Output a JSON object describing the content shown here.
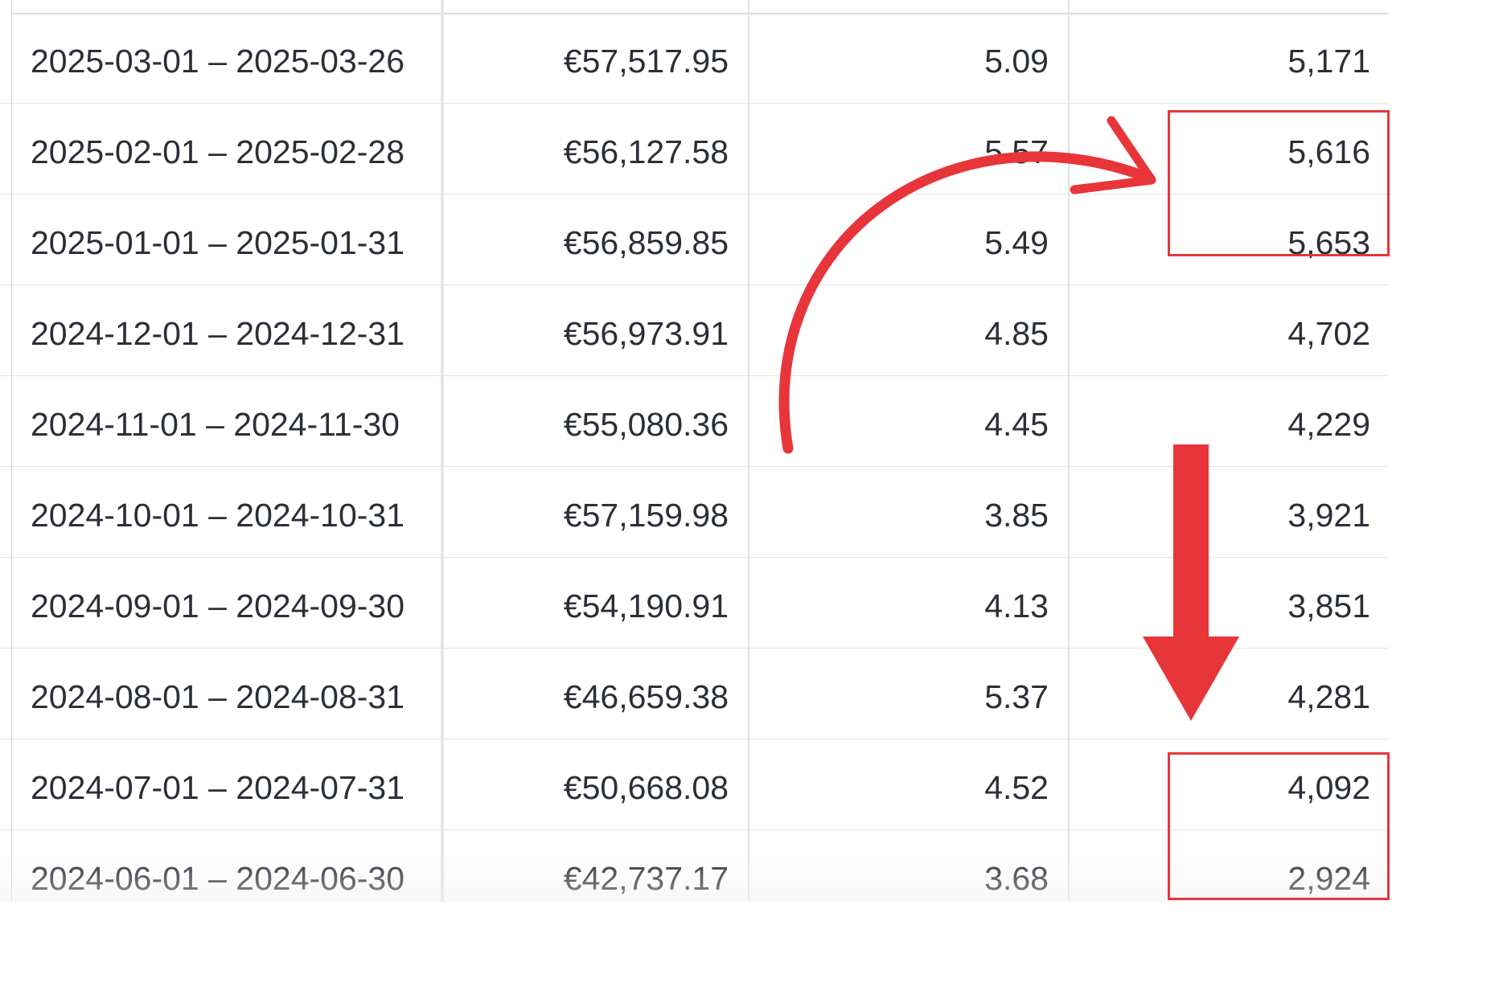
{
  "table": {
    "rows": [
      {
        "range": "2025-03-01 – 2025-03-26",
        "spend": "€57,517.95",
        "rate": "5.09",
        "count": "5,171"
      },
      {
        "range": "2025-02-01 – 2025-02-28",
        "spend": "€56,127.58",
        "rate": "5.57",
        "count": "5,616"
      },
      {
        "range": "2025-01-01 – 2025-01-31",
        "spend": "€56,859.85",
        "rate": "5.49",
        "count": "5,653"
      },
      {
        "range": "2024-12-01 – 2024-12-31",
        "spend": "€56,973.91",
        "rate": "4.85",
        "count": "4,702"
      },
      {
        "range": "2024-11-01 – 2024-11-30",
        "spend": "€55,080.36",
        "rate": "4.45",
        "count": "4,229"
      },
      {
        "range": "2024-10-01 – 2024-10-31",
        "spend": "€57,159.98",
        "rate": "3.85",
        "count": "3,921"
      },
      {
        "range": "2024-09-01 – 2024-09-30",
        "spend": "€54,190.91",
        "rate": "4.13",
        "count": "3,851"
      },
      {
        "range": "2024-08-01 – 2024-08-31",
        "spend": "€46,659.38",
        "rate": "5.37",
        "count": "4,281"
      },
      {
        "range": "2024-07-01 – 2024-07-31",
        "spend": "€50,668.08",
        "rate": "4.52",
        "count": "4,092"
      },
      {
        "range": "2024-06-01 – 2024-06-30",
        "spend": "€42,737.17",
        "rate": "3.68",
        "count": "2,924"
      }
    ]
  },
  "annotations": {
    "color": "#e8353a",
    "highlighted_rows_top": [
      "2025-02-01 – 2025-02-28",
      "2025-01-01 – 2025-01-31"
    ],
    "highlighted_rows_bottom": [
      "2024-07-01 – 2024-07-31",
      "2024-06-01 – 2024-06-30"
    ],
    "curved_arrow": "points-to-top-highlight",
    "down_arrow": "points-to-bottom-highlight"
  }
}
